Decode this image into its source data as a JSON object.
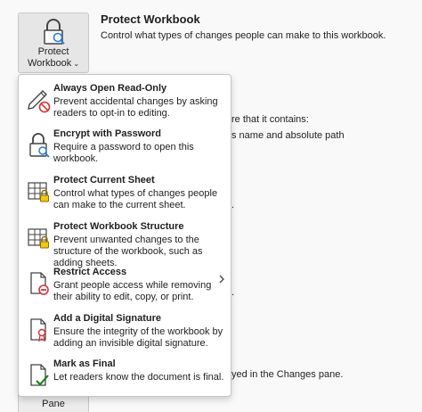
{
  "protect_button": {
    "line1": "Protect",
    "line2": "Workbook",
    "chevron": "⌄"
  },
  "panel": {
    "title": "Protect Workbook",
    "description": "Control what types of changes people can make to this workbook."
  },
  "background_fragments": [
    "re that it contains:",
    "s name and absolute path",
    ".",
    ".",
    "yed in the Changes pane."
  ],
  "pane_button": "Pane",
  "menu": {
    "items": [
      {
        "title": "Always Open Read-Only",
        "desc": "Prevent accidental changes by asking readers to opt-in to editing.",
        "icon": "pencil-no-icon"
      },
      {
        "title": "Encrypt with Password",
        "desc": "Require a password to open this workbook.",
        "icon": "lock-search-icon"
      },
      {
        "title": "Protect Current Sheet",
        "desc": "Control what types of changes people can make to the current sheet.",
        "icon": "sheet-lock-icon"
      },
      {
        "title": "Protect Workbook Structure",
        "desc": "Prevent unwanted changes to the structure of the workbook, such as adding sheets.",
        "icon": "workbook-lock-icon"
      },
      {
        "title": "Restrict Access",
        "desc": "Grant people access while removing their ability to edit, copy, or print.",
        "icon": "document-restrict-icon"
      },
      {
        "title": "Add a Digital Signature",
        "desc": "Ensure the integrity of the workbook by adding an invisible digital signature.",
        "icon": "document-ribbon-icon"
      },
      {
        "title": "Mark as Final",
        "desc": "Let readers know the document is final.",
        "icon": "document-check-icon"
      }
    ]
  }
}
